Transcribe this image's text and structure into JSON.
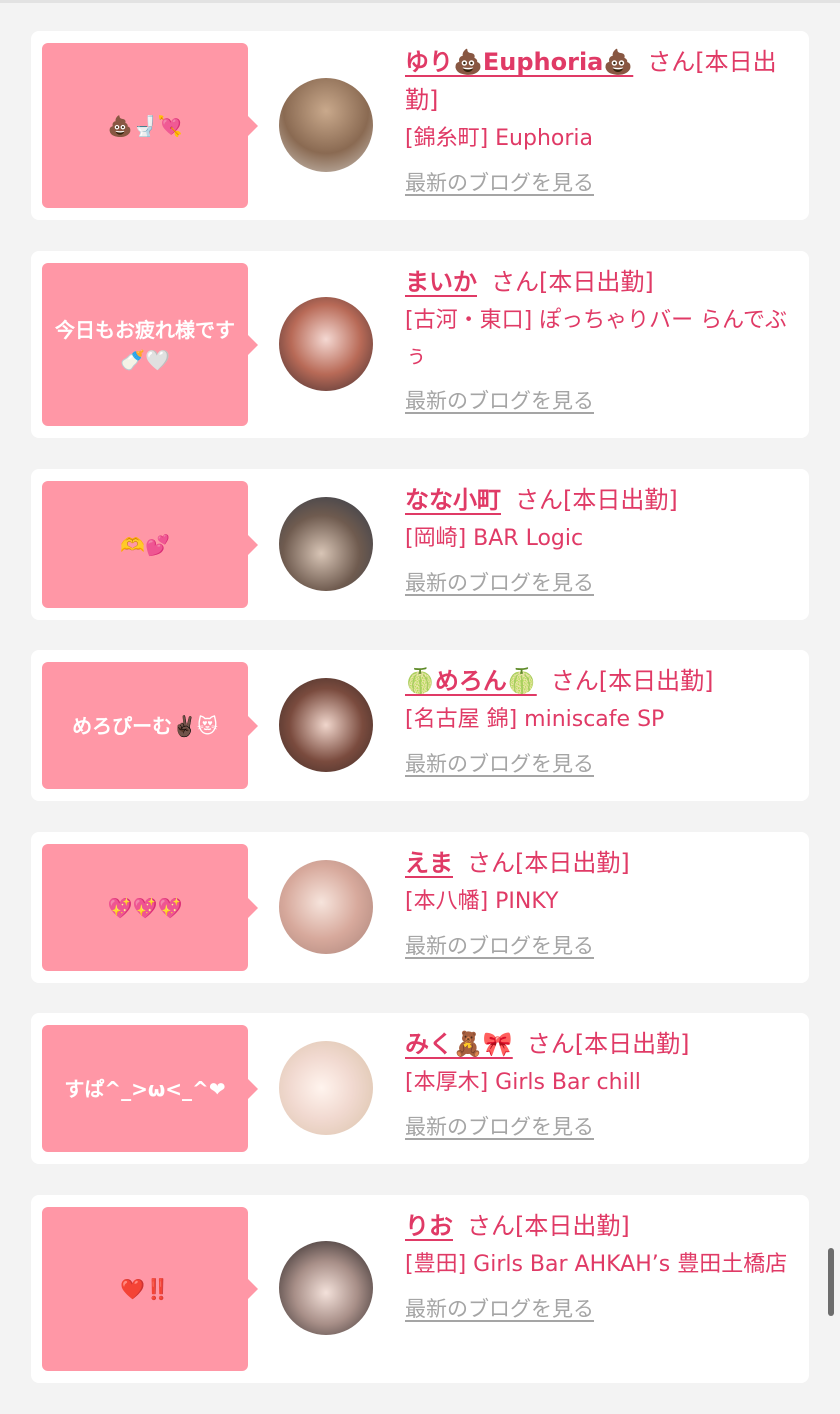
{
  "posts": [
    {
      "bubble": "💩🚽💘",
      "name": "ゆり💩Euphoria💩",
      "suffix": "さん[本日出勤]",
      "shop": "[錦糸町] Euphoria",
      "blog_link": "最新のブログを見る"
    },
    {
      "bubble": "今日もお疲れ様です🍼🤍",
      "name": "まいか",
      "suffix": "さん[本日出勤]",
      "shop": "[古河・東口] ぽっちゃりバー らんでぶぅ",
      "blog_link": "最新のブログを見る"
    },
    {
      "bubble": "🫶💕",
      "name": "なな小町",
      "suffix": "さん[本日出勤]",
      "shop": "[岡崎] BAR Logic",
      "blog_link": "最新のブログを見る"
    },
    {
      "bubble": "めろぴーむ✌🏿😻",
      "name": "🍈めろん🍈",
      "suffix": "さん[本日出勤]",
      "shop": "[名古屋 錦] miniscafe SP",
      "blog_link": "最新のブログを見る"
    },
    {
      "bubble": "💖💖💖",
      "name": "えま",
      "suffix": "さん[本日出勤]",
      "shop": "[本八幡] PINKY",
      "blog_link": "最新のブログを見る"
    },
    {
      "bubble": "すぱ^_>ω<_^❤",
      "name": "みく🧸🎀",
      "suffix": "さん[本日出勤]",
      "shop": "[本厚木] Girls Bar chill",
      "blog_link": "最新のブログを見る"
    },
    {
      "bubble": "❤️‼️",
      "name": "りお",
      "suffix": "さん[本日出勤]",
      "shop": "[豊田] Girls Bar AHKAH’s 豊田土橋店",
      "blog_link": "最新のブログを見る"
    }
  ],
  "colors": {
    "accent": "#e03a66",
    "bubble": "#ff97a6",
    "link_gray": "#a5a5a5",
    "background": "#f3f3f3"
  },
  "avatar_icons": [
    "avatar-photo-icon"
  ]
}
